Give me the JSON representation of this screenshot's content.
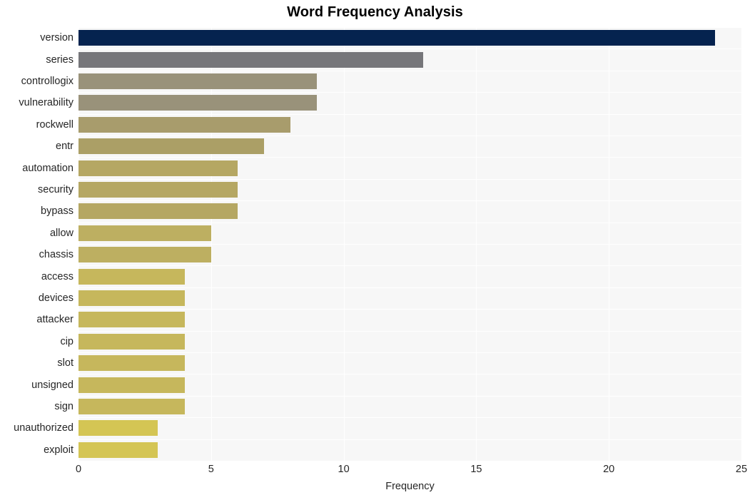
{
  "chart_data": {
    "type": "bar",
    "orientation": "horizontal",
    "title": "Word Frequency Analysis",
    "xlabel": "Frequency",
    "ylabel": "",
    "xlim": [
      0,
      25
    ],
    "xticks": [
      0,
      5,
      10,
      15,
      20,
      25
    ],
    "xtick_labels": [
      "0",
      "5",
      "10",
      "15",
      "20",
      "25"
    ],
    "grid": true,
    "grid_color": "#ffffff",
    "plot_background": "#f7f7f7",
    "legend": null,
    "categories": [
      "version",
      "series",
      "controllogix",
      "vulnerability",
      "rockwell",
      "entr",
      "automation",
      "security",
      "bypass",
      "allow",
      "chassis",
      "access",
      "devices",
      "attacker",
      "cip",
      "slot",
      "unsigned",
      "sign",
      "unauthorized",
      "exploit"
    ],
    "values": [
      24,
      13,
      9,
      9,
      8,
      7,
      6,
      6,
      6,
      5,
      5,
      4,
      4,
      4,
      4,
      4,
      4,
      4,
      3,
      3
    ],
    "bar_colors": [
      "#05234f",
      "#76767a",
      "#99927a",
      "#99927a",
      "#a89c6c",
      "#ab9f66",
      "#b5a763",
      "#b5a763",
      "#b5a763",
      "#bdaf61",
      "#bdaf61",
      "#c6b75c",
      "#c6b75c",
      "#c6b75c",
      "#c6b75c",
      "#c6b75c",
      "#c6b75c",
      "#c6b75c",
      "#d4c554",
      "#d4c554"
    ]
  }
}
